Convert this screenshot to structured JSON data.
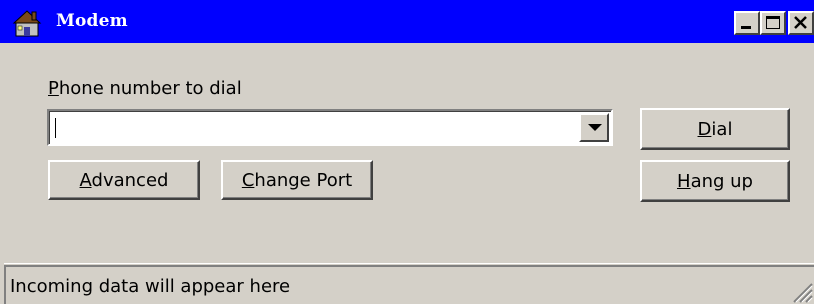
{
  "window": {
    "title": "Modem",
    "icon": "house-icon",
    "controls": {
      "minimize": "minimize-icon",
      "maximize": "maximize-icon",
      "close": "close-icon"
    },
    "colors": {
      "titlebar": "#0000ff",
      "face": "#d4d0c8"
    }
  },
  "form": {
    "phone_label_prefix": "P",
    "phone_label_rest": "hone number to dial",
    "phone_value": "",
    "dial_prefix": "D",
    "dial_rest": "ial",
    "hangup_prefix": "H",
    "hangup_rest": "ang up",
    "advanced_prefix": "A",
    "advanced_rest": "dvanced",
    "changeport_prefix": "C",
    "changeport_rest": "hange Port"
  },
  "status": {
    "text": "Incoming data will appear here"
  }
}
